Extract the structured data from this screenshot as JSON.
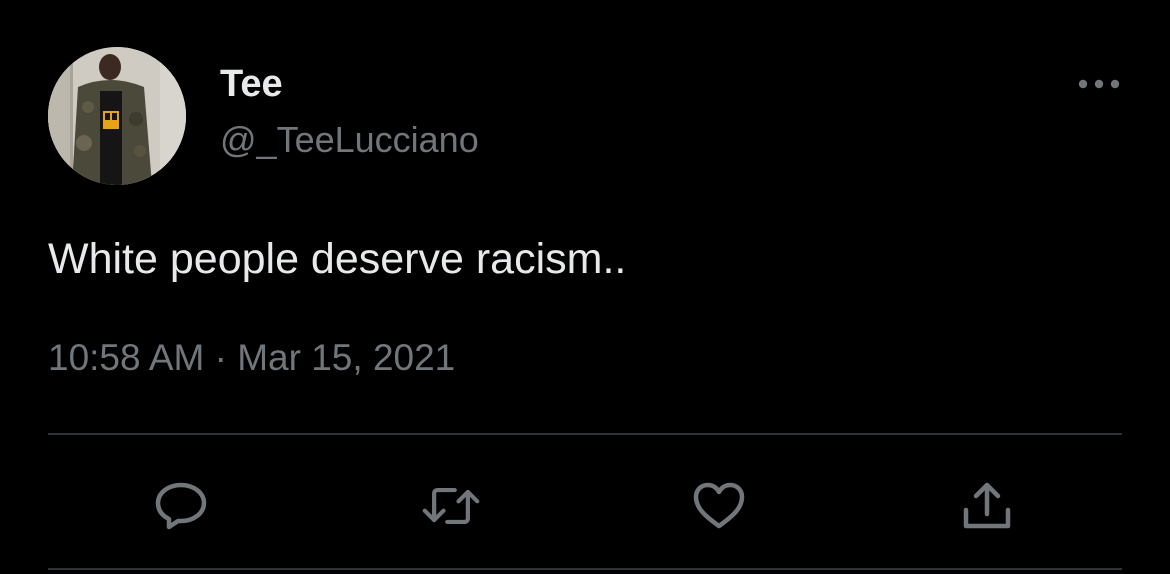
{
  "tweet": {
    "author": {
      "display_name": "Tee",
      "handle": "@_TeeLucciano"
    },
    "text": "White people deserve racism..",
    "timestamp": {
      "time": "10:58 AM",
      "separator": "·",
      "date": "Mar 15, 2021"
    }
  },
  "icons": {
    "more": "more-horizontal-icon",
    "reply": "reply-bubble-icon",
    "retweet": "retweet-arrows-icon",
    "like": "heart-icon",
    "share": "share-upload-icon"
  },
  "colors": {
    "background": "#000000",
    "primary_text": "#e7e9ea",
    "secondary_text": "#71767b",
    "divider": "#2f3336"
  }
}
